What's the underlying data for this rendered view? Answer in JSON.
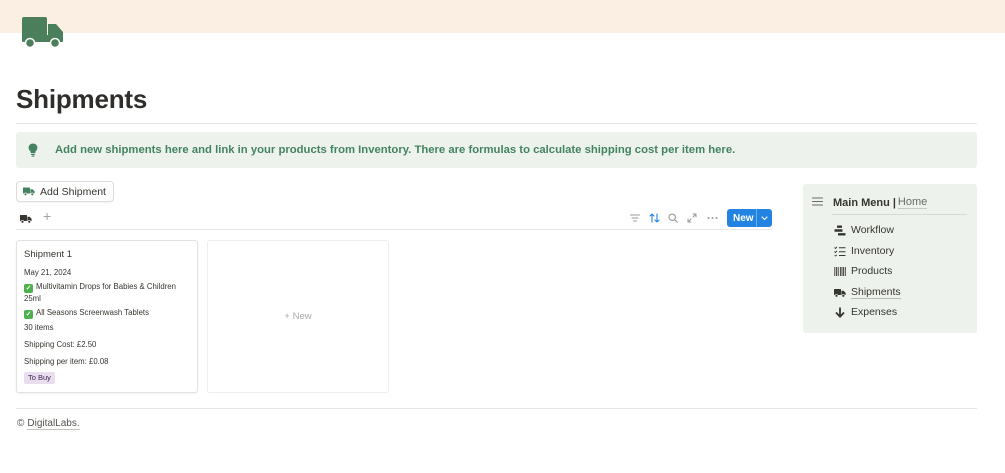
{
  "page": {
    "title": "Shipments",
    "icon": "truck-icon",
    "cover_color": "#fbeee2",
    "accent_green": "#448361"
  },
  "callout": {
    "icon": "lightbulb-icon",
    "text": "Add new shipments here and link in your products from Inventory. There are formulas to calculate shipping cost per item here.",
    "background": "#edf3ec"
  },
  "toolbar": {
    "add_button_label": "Add Shipment",
    "new_button_label": "New",
    "tools": [
      "filter-icon",
      "sort-icon",
      "search-icon",
      "expand-icon",
      "more-icon"
    ]
  },
  "board": {
    "cards": [
      {
        "title": "Shipment 1",
        "date": "May 21, 2024",
        "products": [
          "Multivitamin Drops for Babies & Children 25ml",
          "All Seasons Screenwash Tablets"
        ],
        "items": "30 items",
        "shipping_cost": "Shipping Cost: £2.50",
        "shipping_per_item": "Shipping per item: £0.08",
        "status": "To Buy"
      }
    ],
    "new_card_label": "+ New"
  },
  "menu": {
    "title": "Main Menu",
    "separator": "|",
    "home_label": "Home",
    "items": [
      {
        "label": "Workflow",
        "icon": "workflow-icon"
      },
      {
        "label": "Inventory",
        "icon": "checklist-icon"
      },
      {
        "label": "Products",
        "icon": "barcode-icon"
      },
      {
        "label": "Shipments",
        "icon": "truck-icon"
      },
      {
        "label": "Expenses",
        "icon": "arrow-down-icon"
      }
    ]
  },
  "footer": {
    "copyright": "©",
    "brand": "DigitalLabs."
  }
}
